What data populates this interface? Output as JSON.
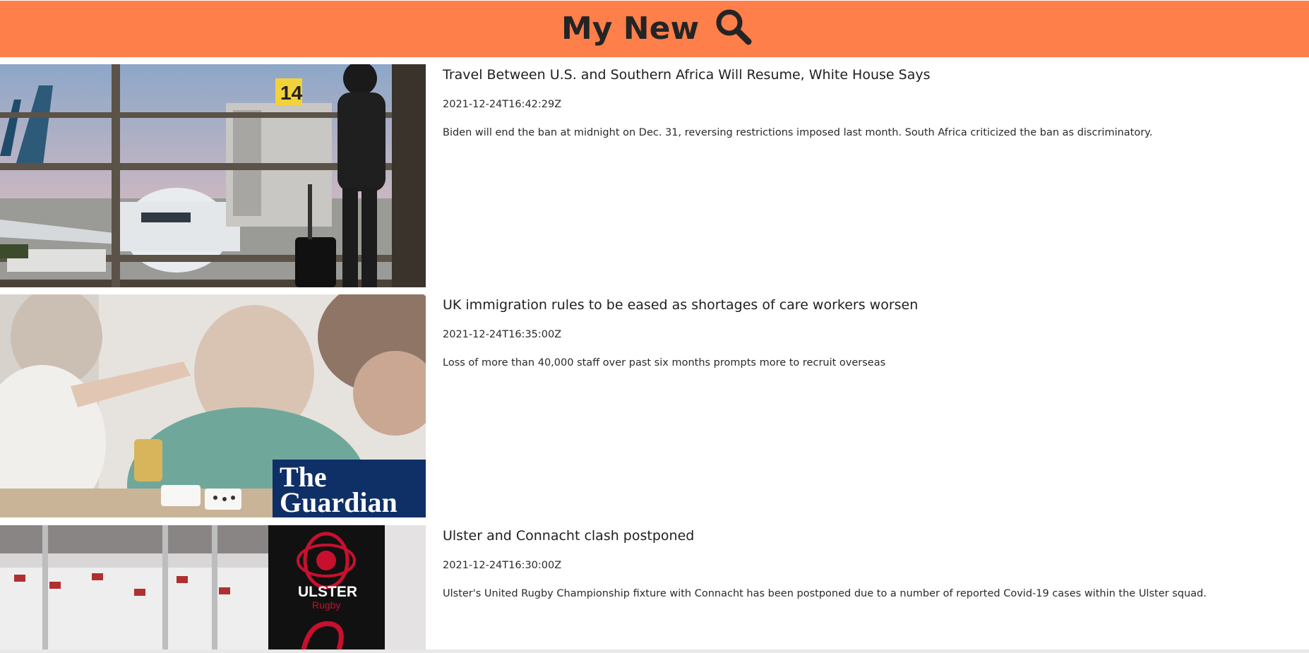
{
  "header": {
    "title": "My New",
    "search_icon": "search-icon",
    "background_color": "#ff7f4b"
  },
  "articles": [
    {
      "title": "Travel Between U.S. and Southern Africa Will Resume, White House Says",
      "published_at": "2021-12-24T16:42:29Z",
      "description": "Biden will end the ban at midnight on Dec. 31, reversing restrictions imposed last month. South Africa criticized the ban as discriminatory.",
      "image_overlay_text": "14"
    },
    {
      "title": "UK immigration rules to be eased as shortages of care workers worsen",
      "published_at": "2021-12-24T16:35:00Z",
      "description": "Loss of more than 40,000 staff over past six months prompts more to recruit overseas",
      "image_logo_line1": "The",
      "image_logo_line2": "Guardian"
    },
    {
      "title": "Ulster and Connacht clash postponed",
      "published_at": "2021-12-24T16:30:00Z",
      "description": "Ulster's United Rugby Championship fixture with Connacht has been postponed due to a number of reported Covid-19 cases within the Ulster squad.",
      "image_logo_line1": "ULSTER",
      "image_logo_line2": "Rugby"
    }
  ]
}
